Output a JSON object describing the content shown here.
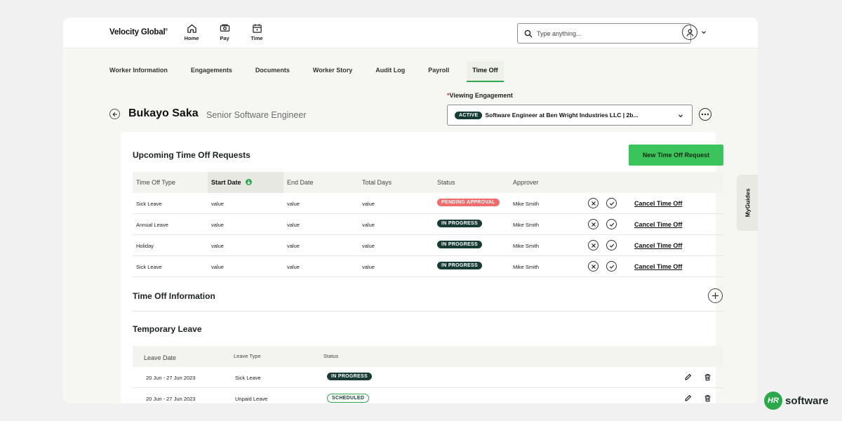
{
  "brand": {
    "name": "Velocity Global",
    "mark": "®"
  },
  "nav": [
    {
      "label": "Home",
      "icon": "home-icon"
    },
    {
      "label": "Pay",
      "icon": "cash-icon"
    },
    {
      "label": "Time",
      "icon": "calendar-icon"
    }
  ],
  "search": {
    "placeholder": "Type anything..."
  },
  "tabs": [
    {
      "label": "Worker Information"
    },
    {
      "label": "Engagements"
    },
    {
      "label": "Documents"
    },
    {
      "label": "Worker Story"
    },
    {
      "label": "Audit Log"
    },
    {
      "label": "Payroll"
    },
    {
      "label": "Time Off",
      "active": true
    }
  ],
  "profile": {
    "name": "Bukayo Saka",
    "role": "Senior Software Engineer"
  },
  "engagement": {
    "required_mark": "*",
    "label": "Viewing Engagement",
    "badge": "ACTIVE",
    "value": "Software Engineer at Ben Wright Industries LLC | 2b..."
  },
  "upcoming": {
    "title": "Upcoming Time Off Requests",
    "new_button": "New Time Off Request",
    "columns": [
      "Time Off Type",
      "Start Date",
      "End Date",
      "Total Days",
      "Status",
      "Approver"
    ],
    "sorted_column": 1,
    "cancel_label": "Cancel Time Off",
    "rows": [
      {
        "type": "Sick Leave",
        "start": "value",
        "end": "value",
        "days": "value",
        "status": "PENDING APPROVAL",
        "status_kind": "pending",
        "approver": "Mike Smith"
      },
      {
        "type": "Annual Leave",
        "start": "value",
        "end": "value",
        "days": "value",
        "status": "IN PROGRESS",
        "status_kind": "progress",
        "approver": "Mike Smith"
      },
      {
        "type": "Holiday",
        "start": "value",
        "end": "value",
        "days": "value",
        "status": "IN PROGRESS",
        "status_kind": "progress",
        "approver": "Mike Smith"
      },
      {
        "type": "Sick Leave",
        "start": "value",
        "end": "value",
        "days": "value",
        "status": "IN PROGRESS",
        "status_kind": "progress",
        "approver": "Mike Smith"
      }
    ]
  },
  "info": {
    "title": "Time Off Information"
  },
  "temporary": {
    "title": "Temporary Leave",
    "columns": [
      "Leave Date",
      "Leave Type",
      "Status"
    ],
    "rows": [
      {
        "date": "20 Jun - 27 Jun 2023",
        "type": "Sick Leave",
        "status": "IN PROGRESS",
        "status_kind": "progress"
      },
      {
        "date": "20 Jun - 27 Jun 2023",
        "type": "Unpaid Leave",
        "status": "SCHEDULED",
        "status_kind": "scheduled"
      }
    ]
  },
  "myguides": {
    "label": "MyGuides"
  },
  "watermark": {
    "logo": "HR",
    "text": "software"
  },
  "colors": {
    "accent_green": "#3ac45b",
    "dark_teal": "#183b36",
    "pending_red": "#f06b6b"
  }
}
